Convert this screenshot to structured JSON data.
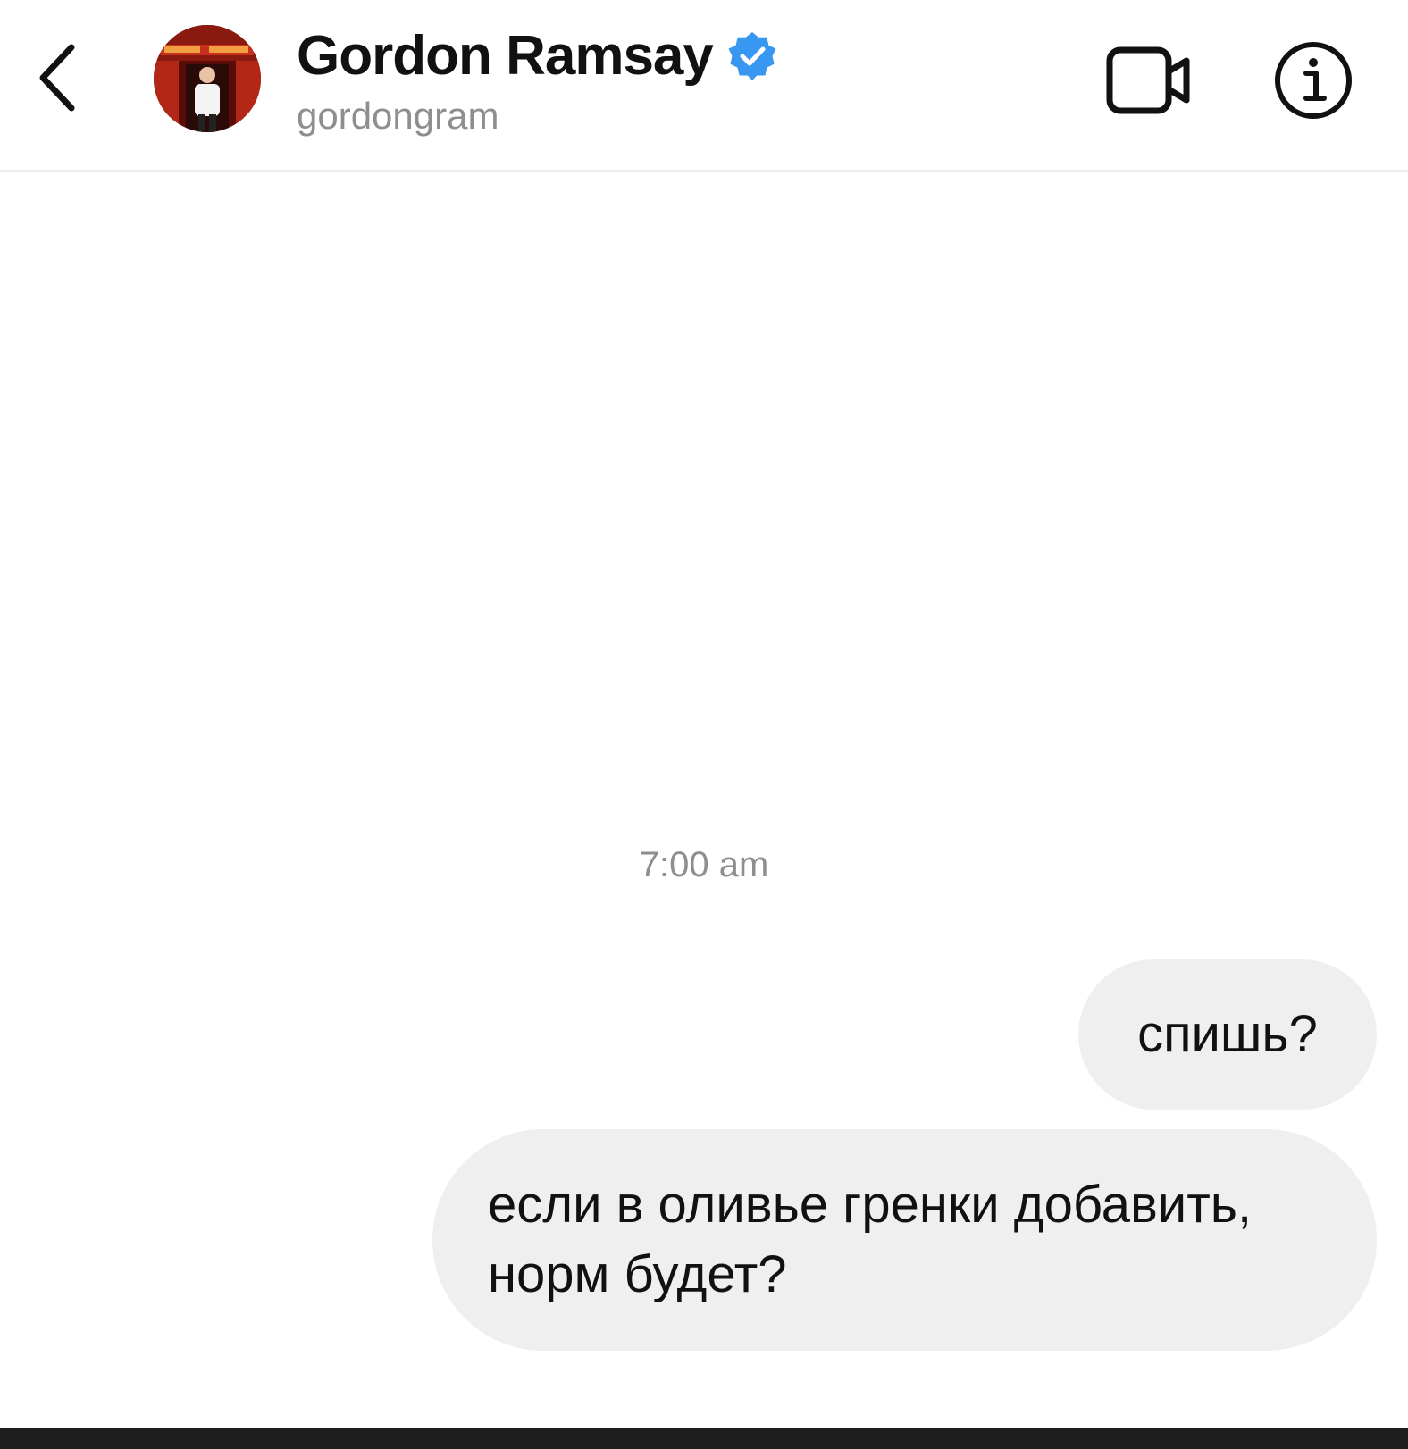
{
  "header": {
    "display_name": "Gordon Ramsay",
    "username": "gordongram",
    "verified": true,
    "icons": {
      "back": "chevron-left-icon",
      "video": "video-camera-icon",
      "info": "info-icon",
      "verified": "verified-badge-icon"
    },
    "colors": {
      "verified_badge": "#3897f0",
      "username": "#8e8e8e"
    }
  },
  "conversation": {
    "timestamp": "7:00 am",
    "messages": [
      {
        "sender": "me",
        "text": "спишь?"
      },
      {
        "sender": "me",
        "text": "если в оливье гренки добавить,\nнорм будет?"
      }
    ],
    "colors": {
      "bubble_background": "#efefef",
      "timestamp": "#8e8e8e"
    }
  }
}
